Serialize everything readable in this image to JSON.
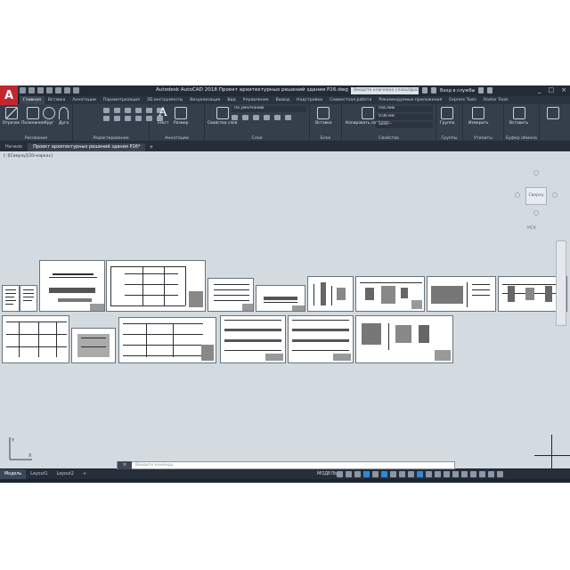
{
  "titlebar": {
    "logo": "A",
    "app_title": "Autodesk AutoCAD 2018   Проект архитектурных решений здания Р26.dwg",
    "search_placeholder": "Введите ключевое слово/фразу",
    "signin": "Вход в службы",
    "win_controls": [
      "_",
      "□",
      "×"
    ]
  },
  "ribbon_tabs": [
    {
      "label": "Главная",
      "active": true
    },
    {
      "label": "Вставка"
    },
    {
      "label": "Аннотации"
    },
    {
      "label": "Параметризация"
    },
    {
      "label": "3D инструменты"
    },
    {
      "label": "Визуализация"
    },
    {
      "label": "Вид"
    },
    {
      "label": "Управление"
    },
    {
      "label": "Вывод"
    },
    {
      "label": "Надстройки"
    },
    {
      "label": "Совместная работа"
    },
    {
      "label": "Рекомендуемые приложения"
    },
    {
      "label": "Express Tools"
    },
    {
      "label": "Raster Tools"
    }
  ],
  "ribbon": {
    "draw_buttons": [
      "Отрезок",
      "Полилиния",
      "Круг",
      "Дуга"
    ],
    "panels": {
      "draw": "Рисование",
      "modify": "Редактирование",
      "annotation": "Аннотации",
      "layers": "Слои",
      "block": "Блок",
      "properties": "Свойства",
      "groups": "Группы",
      "utilities": "Утилиты",
      "clipboard": "Буфер обмена"
    },
    "annotation_buttons": [
      "Текст",
      "Размер"
    ],
    "layer_props_button": "Свойства слоя",
    "layer_combo": "По умолчанию",
    "insert_button": "Вставка",
    "match_props_button": "Копировать свойства",
    "color_combo": "ПоСлою",
    "lineweight_combo": "0.00 мм",
    "linetype_combo": "Solid—",
    "group_button": "Группа",
    "measure_button": "Измерить",
    "paste_button": "Вставить"
  },
  "doc_tabs": [
    {
      "label": "Начало"
    },
    {
      "label": "Проект архитектурных решений здания Р26*",
      "active": true
    }
  ],
  "canvas": {
    "viewport_label": "[–][Сверху][2D-каркас]",
    "viewcube_label": "Сверху",
    "wcs_label": "МСК"
  },
  "command_line": {
    "placeholder": "Введите команду"
  },
  "status_bar": {
    "tabs": [
      {
        "label": "Модель",
        "active": true
      },
      {
        "label": "Layout1"
      },
      {
        "label": "Layout2"
      },
      {
        "label": "+"
      }
    ],
    "model_label": "МОДЕЛЬ"
  }
}
